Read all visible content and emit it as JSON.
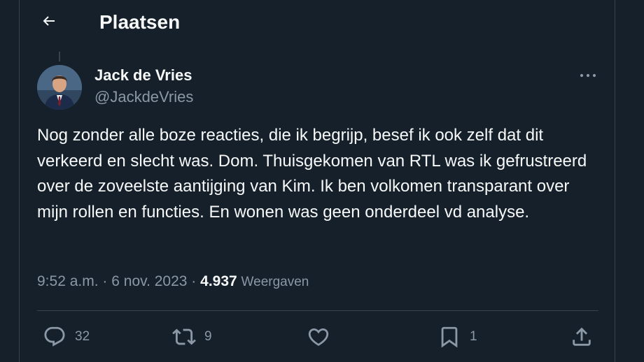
{
  "header": {
    "title": "Plaatsen"
  },
  "post": {
    "author_name": "Jack de Vries",
    "author_handle": "@JackdeVries",
    "text": "Nog zonder alle boze reacties, die ik begrijp, besef ik ook zelf dat dit verkeerd en slecht was. Dom. Thuisgekomen van RTL was ik gefrustreerd over de zoveelste aantijging van Kim. Ik ben volkomen transparant over mijn rollen en functies. En wonen was geen onderdeel vd analyse.",
    "time": "9:52 a.m.",
    "separator": "·",
    "date": "6 nov. 2023",
    "views_count": "4.937",
    "views_label": "Weergaven"
  },
  "actions": {
    "replies": "32",
    "reposts": "9",
    "bookmarks": "1"
  },
  "icons": {
    "back": "arrow-left-icon",
    "more": "more-icon",
    "reply": "reply-icon",
    "repost": "repost-icon",
    "like": "like-icon",
    "bookmark": "bookmark-icon",
    "share": "share-icon"
  },
  "colors": {
    "background": "#15202b",
    "text_primary": "#f7f9f9",
    "text_secondary": "#8b98a5",
    "border": "#38444d"
  }
}
